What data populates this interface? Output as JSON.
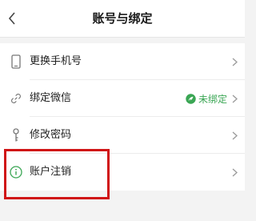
{
  "header": {
    "title": "账号与绑定"
  },
  "settings": {
    "items": [
      {
        "label": "更换手机号",
        "icon": "phone-icon"
      },
      {
        "label": "绑定微信",
        "icon": "link-icon",
        "status": "未绑定",
        "status_icon": "wechat-icon"
      },
      {
        "label": "修改密码",
        "icon": "key-icon"
      },
      {
        "label": "账户注销",
        "icon": "info-circle-icon"
      }
    ]
  },
  "colors": {
    "status_green": "#3aa654",
    "highlight_red": "#d01416"
  }
}
